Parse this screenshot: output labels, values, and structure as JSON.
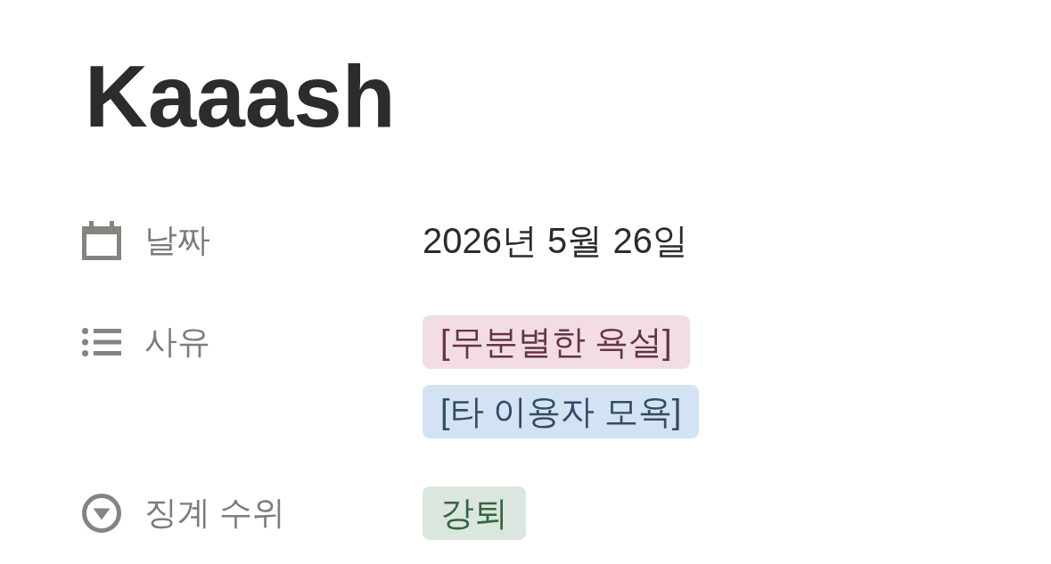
{
  "page": {
    "title": "Kaaash"
  },
  "properties": [
    {
      "kind": "date",
      "name": "날짜",
      "value": "2026년 5월 26일"
    },
    {
      "kind": "multi_select",
      "name": "사유",
      "tags": [
        {
          "label": "[무분별한 욕설]",
          "color": "#f2dde5"
        },
        {
          "label": "[타 이용자 모욕]",
          "color": "#d3e3f4"
        }
      ]
    },
    {
      "kind": "select",
      "name": "징계 수위",
      "tags": [
        {
          "label": "강퇴",
          "color": "#dbe6de"
        }
      ]
    }
  ]
}
